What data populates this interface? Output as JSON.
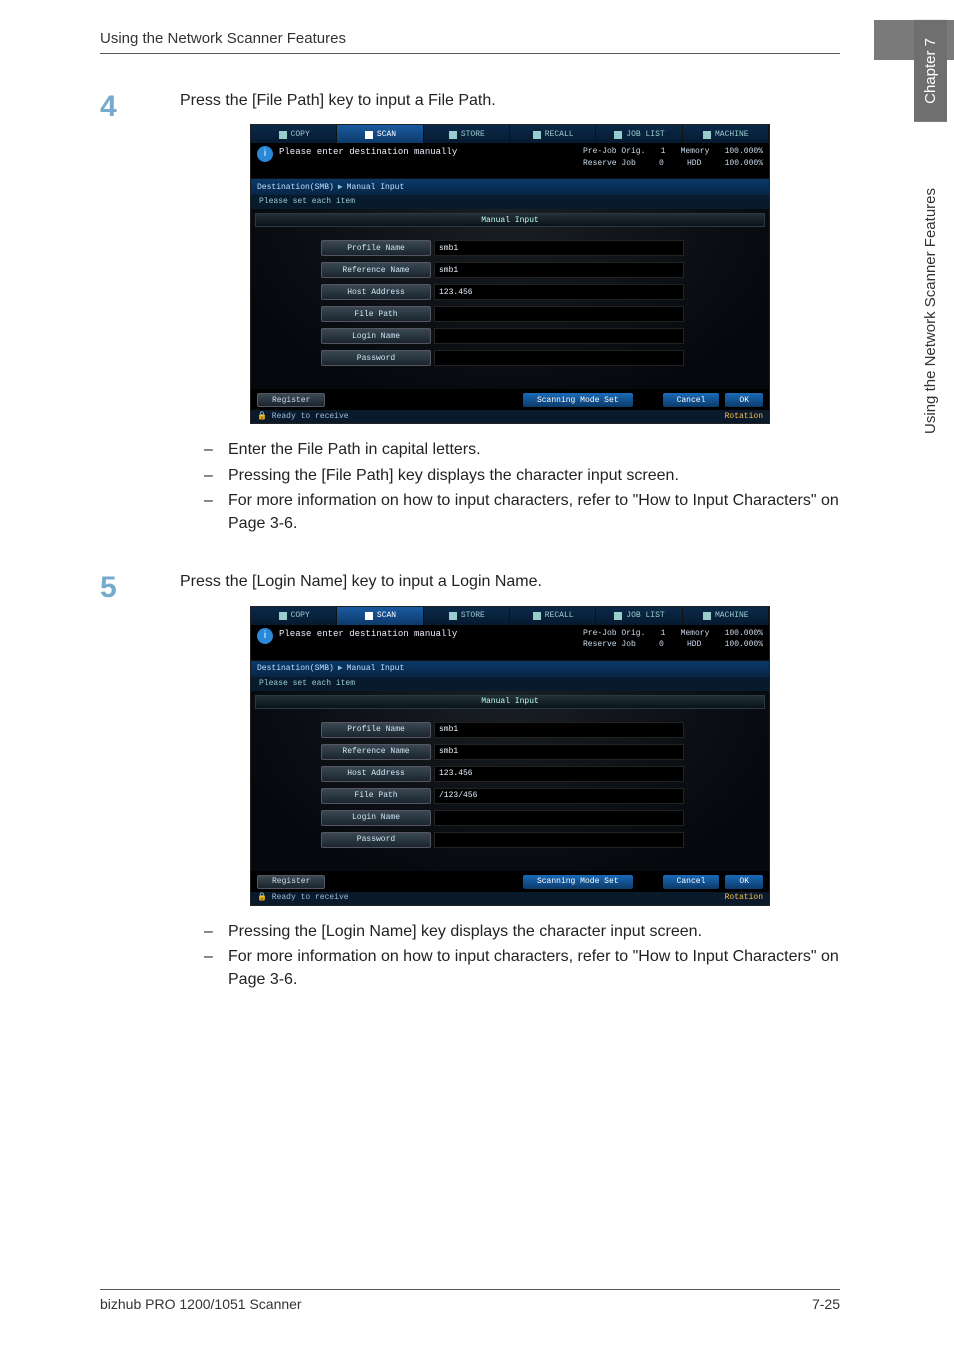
{
  "page": {
    "header_title": "Using the Network Scanner Features",
    "tab_number": "7",
    "side_tab_top": "Chapter 7",
    "side_tab_bottom": "Using the Network Scanner Features",
    "footer_left": "bizhub PRO 1200/1051 Scanner",
    "footer_right": "7-25"
  },
  "step4": {
    "num": "4",
    "text": "Press the [File Path] key to input a File Path.",
    "bullets": [
      "Enter the File Path in capital letters.",
      "Pressing the [File Path] key displays the character input screen.",
      "For more information on how to input characters, refer to \"How to Input Characters\" on Page 3-6."
    ]
  },
  "step5": {
    "num": "5",
    "text": "Press the [Login Name] key to input a Login Name.",
    "bullets": [
      "Pressing the [Login Name] key displays the character input screen.",
      "For more information on how to input characters, refer to \"How to Input Characters\" on Page 3-6."
    ]
  },
  "panel_common": {
    "tabs": {
      "copy": "COPY",
      "scan": "SCAN",
      "store": "STORE",
      "recall": "RECALL",
      "joblist": "JOB LIST",
      "machine": "MACHINE"
    },
    "info_msg": "Please enter destination manually",
    "stats": {
      "prejob_label": "Pre-Job Orig.",
      "prejob_n": "1",
      "mem_label": "Memory",
      "mem_val": "100.000%",
      "reserve_label": "Reserve Job",
      "reserve_n": "0",
      "hdd_label": "HDD",
      "hdd_val": "100.000%"
    },
    "breadcrumb": {
      "a": "Destination(SMB)",
      "b": "Manual Input"
    },
    "sub": "Please set each item",
    "form_title": "Manual Input",
    "labels": {
      "profile": "Profile Name",
      "reference": "Reference Name",
      "host": "Host Address",
      "filepath": "File Path",
      "login": "Login Name",
      "password": "Password"
    },
    "footer": {
      "register": "Register",
      "mode": "Scanning Mode Set",
      "cancel": "Cancel",
      "ok": "OK"
    },
    "status": {
      "ready": "Ready to receive",
      "rotation": "Rotation"
    }
  },
  "panel1_values": {
    "profile": "smb1",
    "reference": "smb1",
    "host": "123.456",
    "filepath": "",
    "login": "",
    "password": ""
  },
  "panel2_values": {
    "profile": "smb1",
    "reference": "smb1",
    "host": "123.456",
    "filepath": "/123/456",
    "login": "",
    "password": ""
  }
}
